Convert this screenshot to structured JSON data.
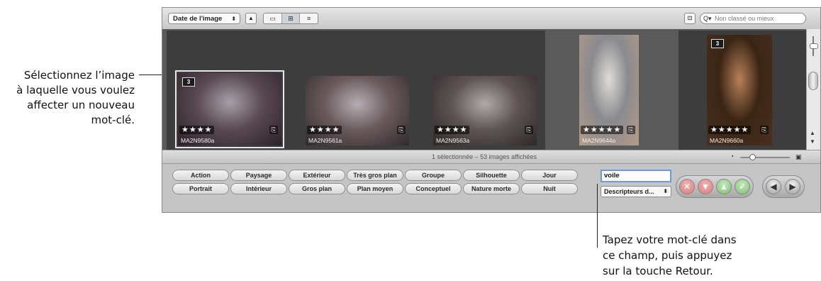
{
  "callouts": {
    "left": [
      "Sélectionnez l’image",
      "à laquelle vous voulez",
      "affecter un nouveau",
      "mot-clé."
    ],
    "bottom": [
      "Tapez votre mot-clé dans",
      "ce champ, puis appuyez",
      "sur la touche Retour."
    ]
  },
  "toolbar": {
    "sort_label": "Date de l'image",
    "sort_arrows": "⬍",
    "sort_order_icon": "▲",
    "view_icons": [
      "▭",
      "⊞",
      "≡"
    ],
    "filter_icon": "⊡",
    "search_icon": "Q▾",
    "search_placeholder": "Non classé ou mieux"
  },
  "thumbnails": [
    {
      "label": "MA2N9580a",
      "stars": "★★★★",
      "stack": "3",
      "selected": true,
      "colors": [
        "#5a4a52",
        "#a6a0a8",
        "#2a2226"
      ]
    },
    {
      "label": "MA2N9561a",
      "stars": "★★★★",
      "stack": "",
      "selected": false,
      "colors": [
        "#6a5a5e",
        "#b5aeb2",
        "#302a2c"
      ]
    },
    {
      "label": "MA2N9563a",
      "stars": "★★★★",
      "stack": "",
      "selected": false,
      "colors": [
        "#5e5454",
        "#b0a9ab",
        "#2e2828"
      ]
    },
    {
      "label": "MA2N9644a",
      "stars": "★★★★★",
      "stack": "",
      "selected": false,
      "colors": [
        "#8a8a8e",
        "#e0ddd8",
        "#b59c8a"
      ]
    },
    {
      "label": "MA2N9660a",
      "stars": "★★★★★",
      "stack": "3",
      "selected": false,
      "colors": [
        "#3a2514",
        "#b8805a",
        "#4a3020"
      ]
    }
  ],
  "note_icon": "⎘",
  "status": {
    "text": "1 sélectionnée – 53 images affichées",
    "zoom_small_icon": "▪",
    "zoom_large_icon": "▣",
    "zoom_level": 0.2
  },
  "scrollbar": {
    "up": "▲",
    "down": "▼"
  },
  "keywords": {
    "row1": [
      "Action",
      "Paysage",
      "Extérieur",
      "Très gros plan",
      "Groupe",
      "Silhouette",
      "Jour"
    ],
    "row2": [
      "Portrait",
      "Intérieur",
      "Gros plan",
      "Plan moyen",
      "Conceptuel",
      "Nature morte",
      "Nuit"
    ],
    "input_value": "voile",
    "set_popup": "Descripteurs d...",
    "set_arrows": "⬍"
  },
  "controls": {
    "reject": "✕",
    "down": "▼",
    "up": "▲",
    "accept": "✓",
    "prev": "◀",
    "next": "▶"
  }
}
